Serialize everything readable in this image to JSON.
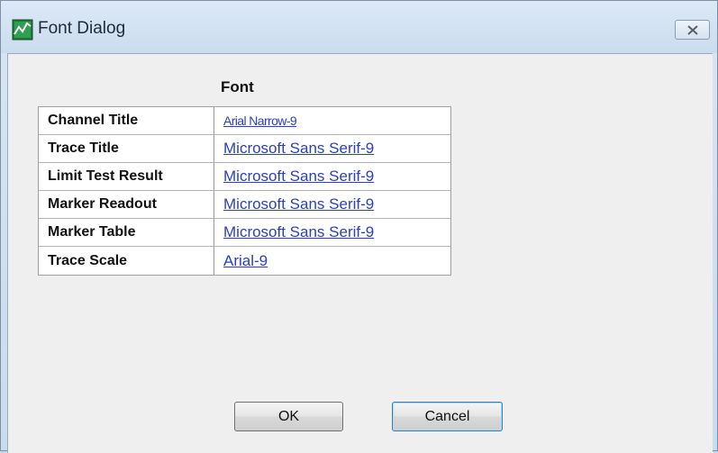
{
  "window": {
    "title": "Font Dialog",
    "close_icon": "close-icon",
    "app_icon": "chart-icon"
  },
  "table": {
    "column_header": "Font",
    "rows": [
      {
        "label": "Channel Title",
        "value": "Arial Narrow-9"
      },
      {
        "label": "Trace Title",
        "value": "Microsoft Sans Serif-9"
      },
      {
        "label": "Limit Test Result",
        "value": "Microsoft Sans Serif-9"
      },
      {
        "label": "Marker Readout",
        "value": "Microsoft Sans Serif-9"
      },
      {
        "label": "Marker Table",
        "value": "Microsoft Sans Serif-9"
      },
      {
        "label": "Trace Scale",
        "value": "Arial-9"
      }
    ]
  },
  "buttons": {
    "ok_label": "OK",
    "cancel_label": "Cancel"
  },
  "colors": {
    "link": "#2a3ec7",
    "titlebar": "#cbdcee",
    "client": "#efefef"
  }
}
